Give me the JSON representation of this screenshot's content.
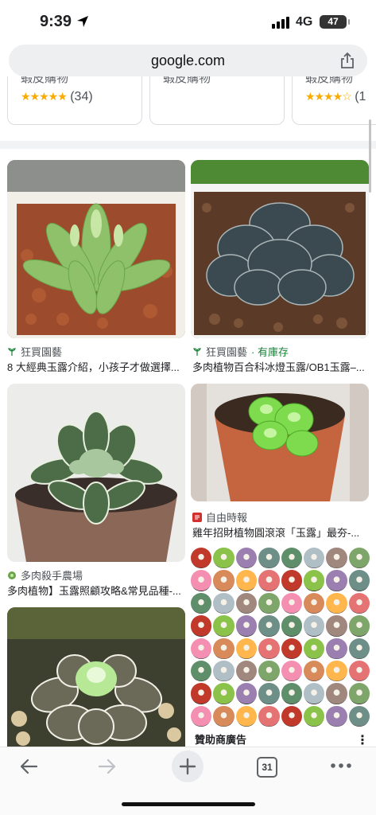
{
  "status": {
    "time": "9:39",
    "network": "4G",
    "battery": "47"
  },
  "browser": {
    "url": "google.com",
    "tab_count": "31"
  },
  "shopping": [
    {
      "title": "蝦皮購物",
      "stars": "★★★★★",
      "count": "(34)"
    },
    {
      "title": "蝦皮購物",
      "stars": "",
      "count": ""
    },
    {
      "title": "蝦皮購物",
      "stars": "★★★★☆",
      "count": "(1"
    }
  ],
  "results": [
    {
      "source": "狂買園藝",
      "stock": "",
      "title": "8 大經典玉露介紹，小孩子才做選擇..."
    },
    {
      "source": "狂買園藝",
      "stock": "· 有庫存",
      "title": "多肉植物百合科冰燈玉露/OB1玉露–..."
    },
    {
      "source": "多肉殺手農場",
      "stock": "",
      "title": "多肉植物】玉露照顧攻略&常見品種-..."
    },
    {
      "source": "自由時報",
      "stock": "",
      "title": "雞年招財植物圓滾滾「玉露」最夯-..."
    }
  ],
  "sponsored": {
    "label": "贊助商廣告"
  },
  "icons": [
    "location-arrow-icon",
    "share-icon",
    "back-icon",
    "forward-icon",
    "new-tab-icon",
    "tabs-icon",
    "more-icon"
  ],
  "colors": {
    "star": "#f9ab00",
    "stock": "#188038",
    "url_bar": "#eeeff1"
  }
}
